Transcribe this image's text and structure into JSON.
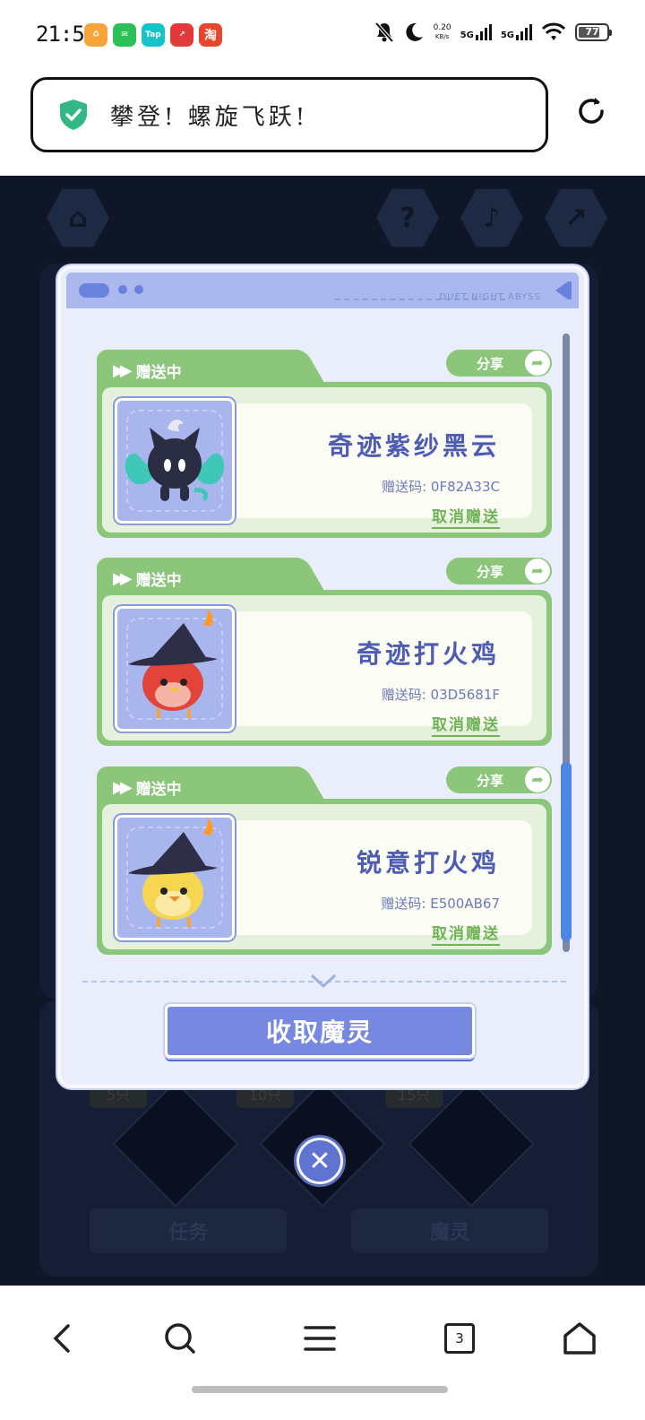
{
  "status_bar": {
    "time": "21:58",
    "apps": [
      {
        "name": "app-icon-1",
        "glyph": "♻",
        "color": "#f5a43a"
      },
      {
        "name": "wechat-icon",
        "glyph": "●",
        "color": "#2bc158"
      },
      {
        "name": "taptap-icon",
        "glyph": "Tap",
        "color": "#17c3c9"
      },
      {
        "name": "news-icon",
        "glyph": "↗",
        "color": "#e23a3a"
      },
      {
        "name": "taobao-icon",
        "glyph": "淘",
        "color": "#e8452c"
      }
    ],
    "net_speed": "0.20",
    "net_unit": "KB/s",
    "sig1": "5G",
    "sig2": "5G",
    "battery": "77"
  },
  "browser": {
    "title": "攀登! 螺旋飞跃!",
    "secure_color": "#33b784"
  },
  "modal": {
    "header_text": "DUET NIGHT ABYSS",
    "items": [
      {
        "status": "赠送中",
        "share": "分享",
        "name": "奇迹紫纱黑云",
        "code": "赠送码: 0F82A33C",
        "cancel": "取消赠送",
        "pet": "black-cat"
      },
      {
        "status": "赠送中",
        "share": "分享",
        "name": "奇迹打火鸡",
        "code": "赠送码: 03D5681F",
        "cancel": "取消赠送",
        "pet": "red-bird"
      },
      {
        "status": "赠送中",
        "share": "分享",
        "name": "锐意打火鸡",
        "code": "赠送码: E500AB67",
        "cancel": "取消赠送",
        "pet": "yellow-bird"
      }
    ],
    "collect": "收取魔灵"
  },
  "background": {
    "task_tab": "任务",
    "spirit_tab": "魔灵",
    "milestones": [
      "5只",
      "10只",
      "15只"
    ]
  },
  "navbar": {
    "tabs_count": "3"
  },
  "colors": {
    "accent_green": "#8cc67a",
    "accent_blue": "#7688e0",
    "name_blue": "#4d5bb2"
  }
}
